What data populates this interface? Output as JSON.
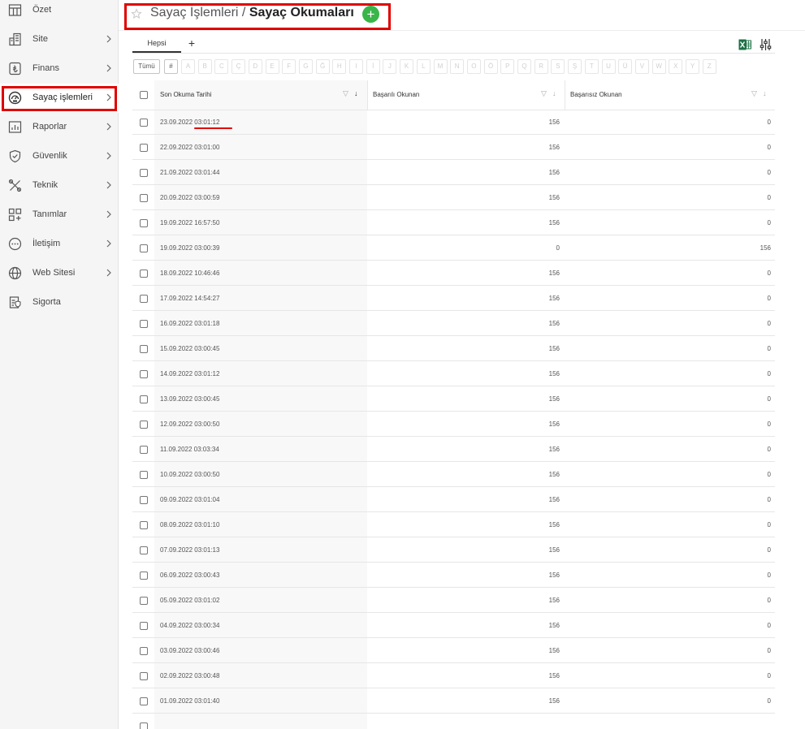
{
  "sidebar": {
    "items": [
      {
        "label": "Özet",
        "icon": "table-icon",
        "chevron": false
      },
      {
        "label": "Site",
        "icon": "building-icon",
        "chevron": true
      },
      {
        "label": "Finans",
        "icon": "lira-icon",
        "chevron": true
      },
      {
        "label": "Sayaç işlemleri",
        "icon": "gauge-icon",
        "chevron": true,
        "active": true
      },
      {
        "label": "Raporlar",
        "icon": "chart-icon",
        "chevron": true
      },
      {
        "label": "Güvenlik",
        "icon": "shield-icon",
        "chevron": true
      },
      {
        "label": "Teknik",
        "icon": "tools-icon",
        "chevron": true
      },
      {
        "label": "Tanımlar",
        "icon": "grid-plus-icon",
        "chevron": true
      },
      {
        "label": "İletişim",
        "icon": "chat-icon",
        "chevron": true
      },
      {
        "label": "Web Sitesi",
        "icon": "globe-icon",
        "chevron": true
      },
      {
        "label": "Sigorta",
        "icon": "insurance-icon",
        "chevron": false
      }
    ]
  },
  "header": {
    "title_prefix": "Sayaç İşlemleri / ",
    "title_main": "Sayaç Okumaları",
    "add_symbol": "+"
  },
  "tabs": {
    "active_label": "Hepsi",
    "add_symbol": "+"
  },
  "alpha_filter": {
    "all_label": "Tümü",
    "hash_label": "#",
    "letters": [
      "A",
      "B",
      "C",
      "Ç",
      "D",
      "E",
      "F",
      "G",
      "Ğ",
      "H",
      "I",
      "İ",
      "J",
      "K",
      "L",
      "M",
      "N",
      "O",
      "Ö",
      "P",
      "Q",
      "R",
      "S",
      "Ş",
      "T",
      "U",
      "Ü",
      "V",
      "W",
      "X",
      "Y",
      "Z"
    ]
  },
  "table": {
    "columns": {
      "date": "Son Okuma Tarihi",
      "success": "Başarılı Okunan",
      "fail": "Başarısız Okunan"
    },
    "rows": [
      {
        "date": "23.09.2022 03:01:12",
        "success": "156",
        "fail": "0"
      },
      {
        "date": "22.09.2022 03:01:00",
        "success": "156",
        "fail": "0"
      },
      {
        "date": "21.09.2022 03:01:44",
        "success": "156",
        "fail": "0"
      },
      {
        "date": "20.09.2022 03:00:59",
        "success": "156",
        "fail": "0"
      },
      {
        "date": "19.09.2022 16:57:50",
        "success": "156",
        "fail": "0"
      },
      {
        "date": "19.09.2022 03:00:39",
        "success": "0",
        "fail": "156"
      },
      {
        "date": "18.09.2022 10:46:46",
        "success": "156",
        "fail": "0"
      },
      {
        "date": "17.09.2022 14:54:27",
        "success": "156",
        "fail": "0"
      },
      {
        "date": "16.09.2022 03:01:18",
        "success": "156",
        "fail": "0"
      },
      {
        "date": "15.09.2022 03:00:45",
        "success": "156",
        "fail": "0"
      },
      {
        "date": "14.09.2022 03:01:12",
        "success": "156",
        "fail": "0"
      },
      {
        "date": "13.09.2022 03:00:45",
        "success": "156",
        "fail": "0"
      },
      {
        "date": "12.09.2022 03:00:50",
        "success": "156",
        "fail": "0"
      },
      {
        "date": "11.09.2022 03:03:34",
        "success": "156",
        "fail": "0"
      },
      {
        "date": "10.09.2022 03:00:50",
        "success": "156",
        "fail": "0"
      },
      {
        "date": "09.09.2022 03:01:04",
        "success": "156",
        "fail": "0"
      },
      {
        "date": "08.09.2022 03:01:10",
        "success": "156",
        "fail": "0"
      },
      {
        "date": "07.09.2022 03:01:13",
        "success": "156",
        "fail": "0"
      },
      {
        "date": "06.09.2022 03:00:43",
        "success": "156",
        "fail": "0"
      },
      {
        "date": "05.09.2022 03:01:02",
        "success": "156",
        "fail": "0"
      },
      {
        "date": "04.09.2022 03:00:34",
        "success": "156",
        "fail": "0"
      },
      {
        "date": "03.09.2022 03:00:46",
        "success": "156",
        "fail": "0"
      },
      {
        "date": "02.09.2022 03:00:48",
        "success": "156",
        "fail": "0"
      },
      {
        "date": "01.09.2022 03:01:40",
        "success": "156",
        "fail": "0"
      }
    ]
  },
  "colors": {
    "highlight": "#e00000",
    "add_green": "#39b54a",
    "excel_green": "#1e7145"
  }
}
